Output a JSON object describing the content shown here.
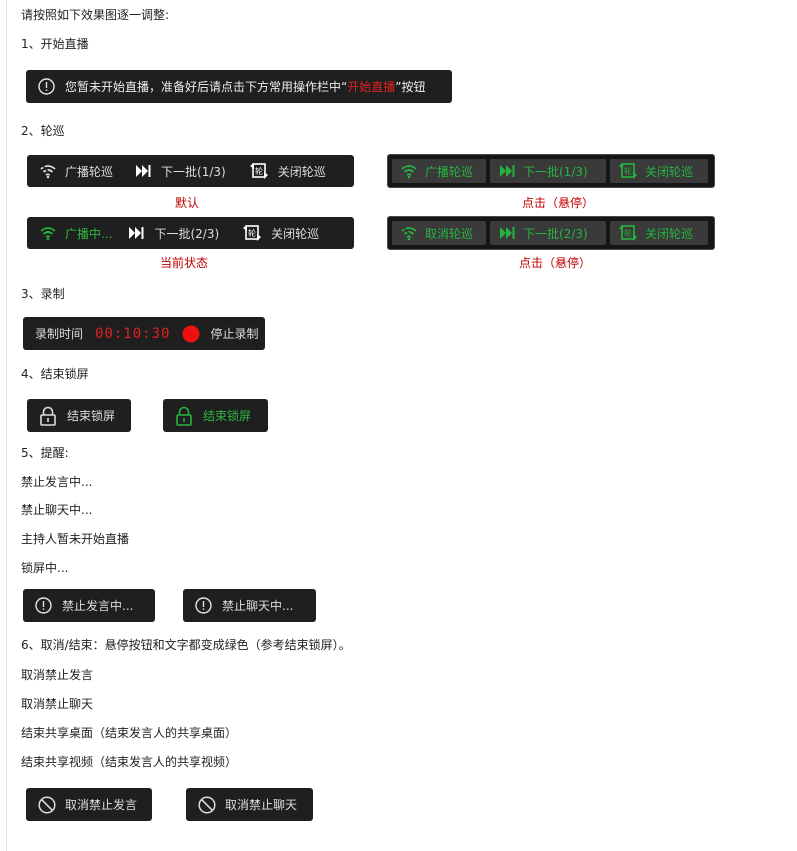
{
  "intro": "请按照如下效果图逐一调整:",
  "s1": {
    "heading": "1、开始直播",
    "notice": {
      "before": "您暂未开始直播，准备好后请点击下方常用操作栏中“",
      "highlight": "开始直播",
      "after": "”按钮"
    }
  },
  "s2": {
    "heading": "2、轮巡",
    "default_bar": {
      "broadcast": "广播轮巡",
      "next": "下一批(1/3)",
      "close": "关闭轮巡"
    },
    "default_caption": "默认",
    "hover_bar1": {
      "broadcast": "广播轮巡",
      "next": "下一批(1/3)",
      "close": "关闭轮巡"
    },
    "hover_caption1": "点击（悬停）",
    "current_bar": {
      "broadcast": "广播中...",
      "next": "下一批(2/3)",
      "close": "关闭轮巡"
    },
    "current_caption": "当前状态",
    "hover_bar2": {
      "cancel": "取消轮巡",
      "next": "下一批(2/3)",
      "close": "关闭轮巡"
    },
    "hover_caption2": "点击（悬停）"
  },
  "s3": {
    "heading": "3、录制",
    "label": "录制时间",
    "time": "00:10:30",
    "stop": "停止录制"
  },
  "s4": {
    "heading": "4、结束锁屏",
    "btn_default": "结束锁屏",
    "btn_hover": "结束锁屏"
  },
  "s5": {
    "heading": "5、提醒:",
    "lines": [
      "禁止发言中...",
      "禁止聊天中...",
      "主持人暂未开始直播",
      "锁屏中..."
    ],
    "btn_speech": "禁止发言中...",
    "btn_chat": "禁止聊天中..."
  },
  "s6": {
    "heading": "6、取消/结束：悬停按钮和文字都变成绿色（参考结束锁屏）。",
    "lines": [
      "取消禁止发言",
      "取消禁止聊天",
      "结束共享桌面（结束发言人的共享桌面）",
      "结束共享视频（结束发言人的共享视频）"
    ],
    "btn_speech": "取消禁止发言",
    "btn_chat": "取消禁止聊天"
  },
  "colors": {
    "bar": "#1f1f1f",
    "hover_green": "#26b440",
    "caption_red": "#c00000",
    "timer_red": "#e02020"
  }
}
